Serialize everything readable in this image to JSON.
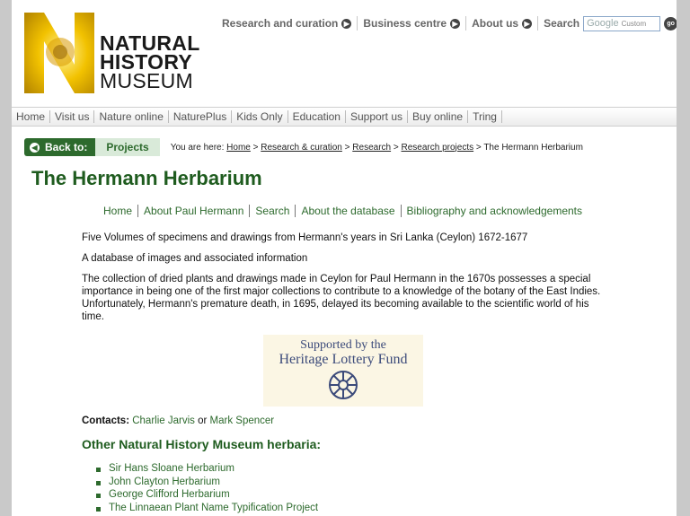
{
  "logo": {
    "line1": "NATURAL",
    "line2": "HISTORY",
    "line3": "MUSEUM"
  },
  "top_nav": {
    "items": [
      "Research and curation",
      "Business centre",
      "About us"
    ],
    "search_label": "Search",
    "search_placeholder": "Google",
    "search_custom": "Custom",
    "go_label": "go"
  },
  "main_nav": [
    "Home",
    "Visit us",
    "Nature online",
    "NaturePlus",
    "Kids Only",
    "Education",
    "Support us",
    "Buy online",
    "Tring"
  ],
  "breadcrumb": {
    "back_label": "Back to:",
    "projects_label": "Projects",
    "you_are_here": "You are here:",
    "links": [
      "Home",
      "Research & curation",
      "Research",
      "Research projects"
    ],
    "current": "The Hermann Herbarium",
    "sep": ">"
  },
  "page_title": "The Hermann Herbarium",
  "sub_nav": [
    "Home",
    "About Paul Hermann",
    "Search",
    "About the database",
    "Bibliography and acknowledgements"
  ],
  "intro": {
    "p1": "Five Volumes of specimens and drawings from Hermann's years in Sri Lanka (Ceylon) 1672-1677",
    "p2": "A database of images and associated information",
    "p3": "The collection of dried plants and drawings made in Ceylon for Paul Hermann in the 1670s possesses a special importance in being one of the first major collections to contribute to a knowledge of the botany of the East Indies. Unfortunately, Hermann's premature death, in 1695, delayed its becoming available to the scientific world of his time."
  },
  "sponsor": {
    "line1": "Supported by the",
    "line2": "Heritage Lottery Fund"
  },
  "contacts": {
    "label": "Contacts:",
    "person1": "Charlie Jarvis",
    "or": "or",
    "person2": "Mark Spencer"
  },
  "other_herbaria": {
    "heading": "Other Natural History Museum herbaria:",
    "items": [
      "Sir Hans Sloane Herbarium",
      "John Clayton Herbarium",
      "George Clifford Herbarium",
      "The Linnaean Plant Name Typification Project"
    ]
  },
  "colors": {
    "accent_green": "#2d6a2d",
    "title_green": "#1f5c1f",
    "logo_yellow": "#f2c200"
  }
}
